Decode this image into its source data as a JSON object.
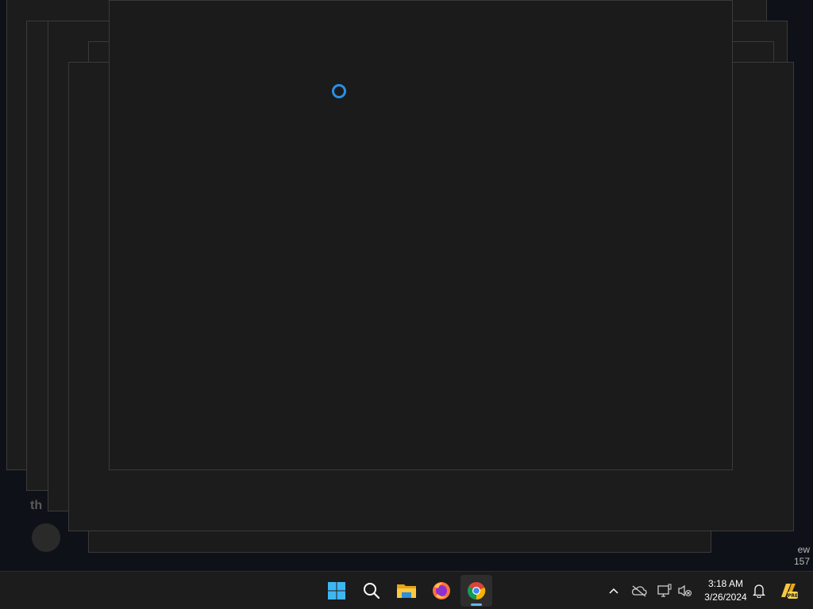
{
  "background": {
    "behind_text_1": "th",
    "side_text_1": "ew",
    "side_text_2": "157"
  },
  "taskbar": {
    "icons": [
      {
        "name": "start",
        "icon": "windows-logo-icon"
      },
      {
        "name": "search",
        "icon": "search-icon"
      },
      {
        "name": "file-explorer",
        "icon": "folder-icon"
      },
      {
        "name": "firefox",
        "icon": "firefox-icon"
      },
      {
        "name": "chrome",
        "icon": "chrome-icon",
        "active": true
      }
    ],
    "tray": {
      "time": "3:18 AM",
      "date": "3/26/2024"
    }
  },
  "colors": {
    "accent": "#2b8ee6",
    "taskbar": "#1c1c1c",
    "window": "#1b1b1b"
  }
}
